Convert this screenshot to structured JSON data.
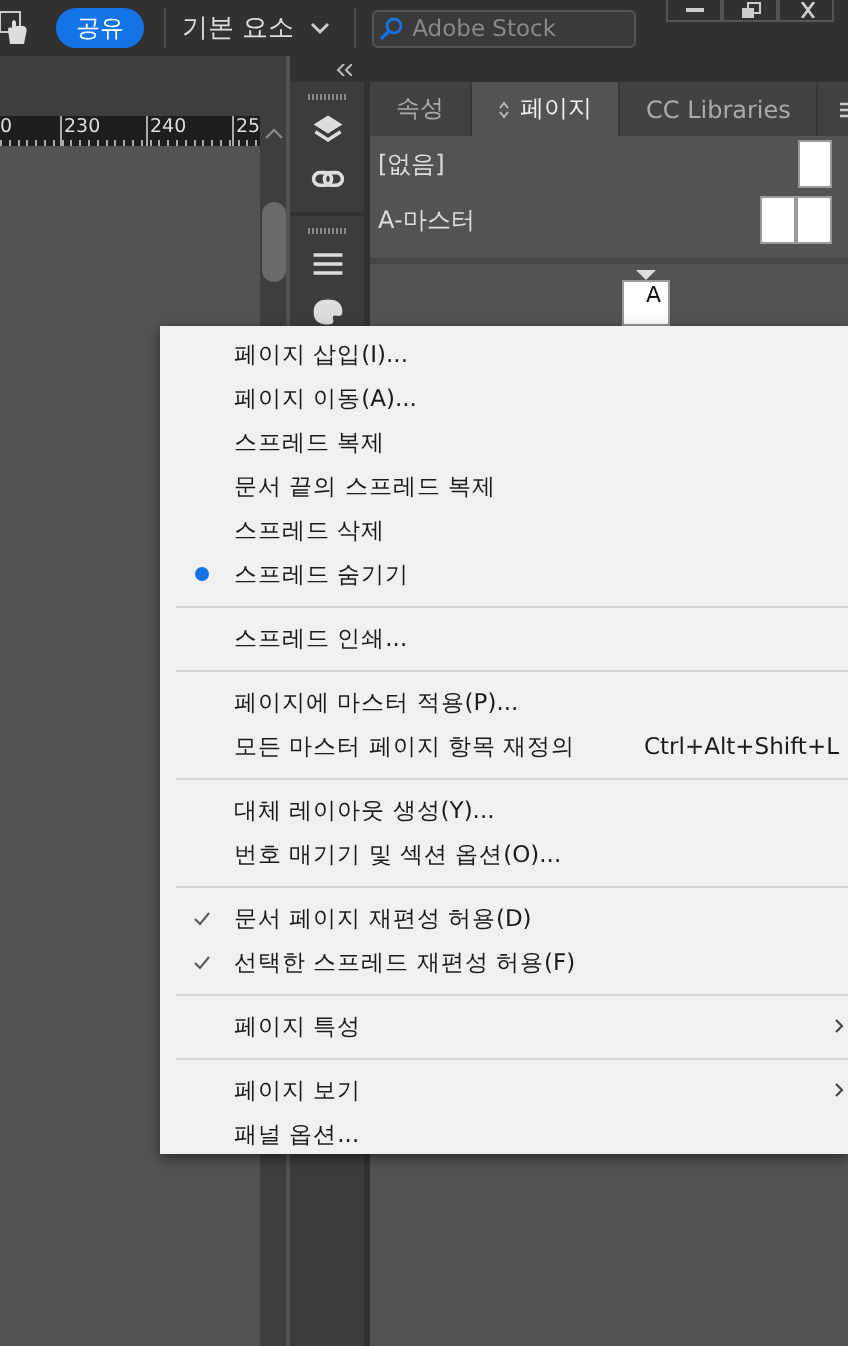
{
  "top_bar": {
    "share_button": "공유",
    "workspace": "기본 요소",
    "search": {
      "placeholder": "Adobe Stock"
    }
  },
  "ruler": {
    "labels": [
      "0",
      "230",
      "240",
      "25"
    ]
  },
  "panel": {
    "tabs": [
      {
        "label": "속성",
        "selected": false
      },
      {
        "label": "페이지",
        "selected": true
      },
      {
        "label": "CC Libraries",
        "selected": false
      }
    ],
    "masters": [
      {
        "name": "[없음]",
        "kind": "single"
      },
      {
        "name": "A-마스터",
        "kind": "spread"
      }
    ],
    "page_label": "A"
  },
  "context_menu": {
    "items": [
      {
        "kind": "item",
        "label": "페이지 삽입(I)...",
        "bullet": false,
        "checked": false,
        "submenu": false
      },
      {
        "kind": "item",
        "label": "페이지 이동(A)...",
        "bullet": false,
        "checked": false,
        "submenu": false
      },
      {
        "kind": "item",
        "label": "스프레드 복제",
        "bullet": false,
        "checked": false,
        "submenu": false
      },
      {
        "kind": "item",
        "label": "문서 끝의 스프레드 복제",
        "bullet": false,
        "checked": false,
        "submenu": false
      },
      {
        "kind": "item",
        "label": "스프레드 삭제",
        "bullet": false,
        "checked": false,
        "submenu": false
      },
      {
        "kind": "item",
        "label": "스프레드 숨기기",
        "bullet": true,
        "checked": false,
        "submenu": false
      },
      {
        "kind": "separator"
      },
      {
        "kind": "item",
        "label": "스프레드 인쇄...",
        "bullet": false,
        "checked": false,
        "submenu": false
      },
      {
        "kind": "separator"
      },
      {
        "kind": "item",
        "label": "페이지에 마스터 적용(P)...",
        "bullet": false,
        "checked": false,
        "submenu": false
      },
      {
        "kind": "item",
        "label": "모든 마스터 페이지 항목 재정의",
        "shortcut": "Ctrl+Alt+Shift+L",
        "bullet": false,
        "checked": false,
        "submenu": false
      },
      {
        "kind": "separator"
      },
      {
        "kind": "item",
        "label": "대체 레이아웃 생성(Y)...",
        "bullet": false,
        "checked": false,
        "submenu": false
      },
      {
        "kind": "item",
        "label": "번호 매기기 및 섹션 옵션(O)...",
        "bullet": false,
        "checked": false,
        "submenu": false
      },
      {
        "kind": "separator"
      },
      {
        "kind": "item",
        "label": "문서 페이지 재편성 허용(D)",
        "bullet": false,
        "checked": true,
        "submenu": false
      },
      {
        "kind": "item",
        "label": "선택한 스프레드 재편성 허용(F)",
        "bullet": false,
        "checked": true,
        "submenu": false
      },
      {
        "kind": "separator"
      },
      {
        "kind": "item",
        "label": "페이지 특성",
        "bullet": false,
        "checked": false,
        "submenu": true
      },
      {
        "kind": "separator"
      },
      {
        "kind": "item",
        "label": "페이지 보기",
        "bullet": false,
        "checked": false,
        "submenu": true
      },
      {
        "kind": "item",
        "label": "패널 옵션...",
        "bullet": false,
        "checked": false,
        "submenu": false
      }
    ]
  }
}
